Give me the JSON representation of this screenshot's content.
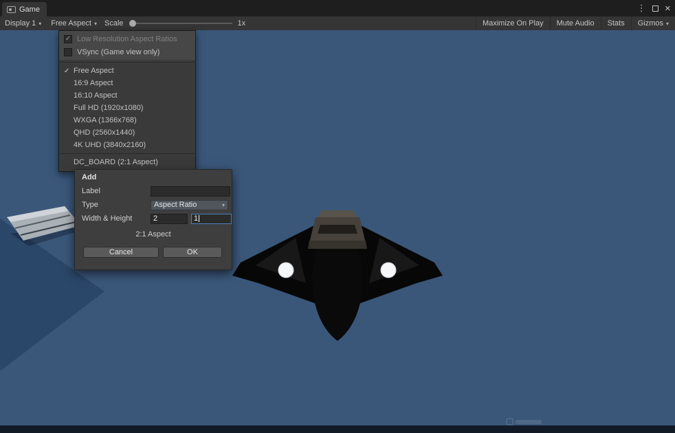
{
  "icons": {
    "chevron_down": "▾",
    "check": "✓",
    "kebab_menu": "⋮",
    "close": "✕"
  },
  "window": {
    "tab_label": "Game"
  },
  "toolbar": {
    "display": "Display 1",
    "aspect": "Free Aspect",
    "scale_label": "Scale",
    "scale_value": "1x",
    "maximize_on_play": "Maximize On Play",
    "mute_audio": "Mute Audio",
    "stats": "Stats",
    "gizmos": "Gizmos"
  },
  "aspect_menu": {
    "items": [
      {
        "label": "Low Resolution Aspect Ratios",
        "checked": true,
        "disabled": true
      },
      {
        "label": "VSync (Game view only)",
        "checked": false
      },
      {
        "label": "Free Aspect",
        "checked": true
      },
      {
        "label": "16:9 Aspect"
      },
      {
        "label": "16:10 Aspect"
      },
      {
        "label": "Full HD (1920x1080)"
      },
      {
        "label": "WXGA (1366x768)"
      },
      {
        "label": "QHD (2560x1440)"
      },
      {
        "label": "4K UHD (3840x2160)"
      },
      {
        "label": "DC_BOARD (2:1 Aspect)"
      }
    ]
  },
  "add_dialog": {
    "title": "Add",
    "label_label": "Label",
    "label_value": "",
    "type_label": "Type",
    "type_value": "Aspect Ratio",
    "wh_label": "Width & Height",
    "width_value": "2",
    "height_value": "1",
    "preview": "2:1 Aspect",
    "cancel_label": "Cancel",
    "ok_label": "OK"
  },
  "colors": {
    "viewport_blue": "#3a577a",
    "focus_blue": "#4f7fbf",
    "menu_bg": "#3a3a3a",
    "dialog_bg": "#3e3e3e"
  }
}
